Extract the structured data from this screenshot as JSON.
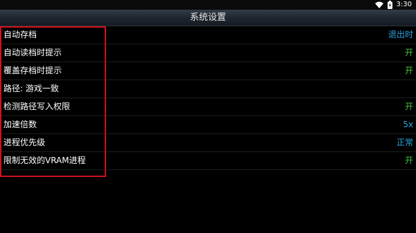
{
  "status_bar": {
    "time": "3:30",
    "icons": [
      "wifi-icon",
      "battery-icon"
    ]
  },
  "title_bar": {
    "title": "系统设置"
  },
  "settings": [
    {
      "label": "自动存档",
      "value": "退出时",
      "value_color": "#2aa7e0"
    },
    {
      "label": "自动读档时提示",
      "value": "开",
      "value_color": "#45c43a"
    },
    {
      "label": "覆盖存档时提示",
      "value": "开",
      "value_color": "#45c43a"
    },
    {
      "label": "路径: 游戏一致",
      "value": "",
      "value_color": ""
    },
    {
      "label": "检测路径写入权限",
      "value": "开",
      "value_color": "#45c43a"
    },
    {
      "label": "加速倍数",
      "value": "5x",
      "value_color": "#2aa7e0"
    },
    {
      "label": "进程优先级",
      "value": "正常",
      "value_color": "#2aa7e0"
    },
    {
      "label": "限制无效的VRAM进程",
      "value": "开",
      "value_color": "#45c43a"
    }
  ],
  "colors": {
    "background": "#000000",
    "highlight_border": "#d0121b",
    "blue_value": "#2aa7e0",
    "green_value": "#45c43a"
  }
}
